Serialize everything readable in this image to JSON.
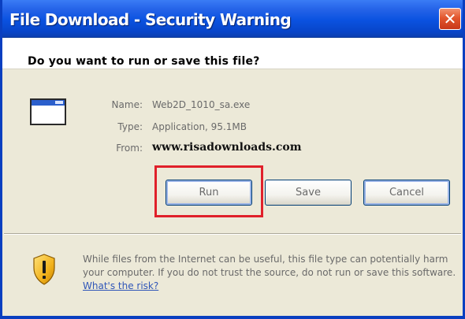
{
  "window": {
    "title": "File Download - Security Warning",
    "close_glyph": "✕"
  },
  "dialog": {
    "question": "Do you want to run or save this file?",
    "file_icon": "application-window-icon",
    "name_label": "Name:",
    "name_value": "Web2D_1010_sa.exe",
    "type_label": "Type:",
    "type_value": "Application, 95.1MB",
    "from_label": "From:",
    "from_value": "www.risadownloads.com"
  },
  "buttons": {
    "run": "Run",
    "save": "Save",
    "cancel": "Cancel"
  },
  "warning": {
    "icon": "shield-warning-icon",
    "text": "While files from the Internet can be useful, this file type can potentially harm your computer. If you do not trust the source, do not run or save this software.",
    "link": "What's the risk?"
  },
  "colors": {
    "titlebar": "#0a52e0",
    "dialog_bg": "#ece9d8",
    "highlight": "#e0202a"
  }
}
